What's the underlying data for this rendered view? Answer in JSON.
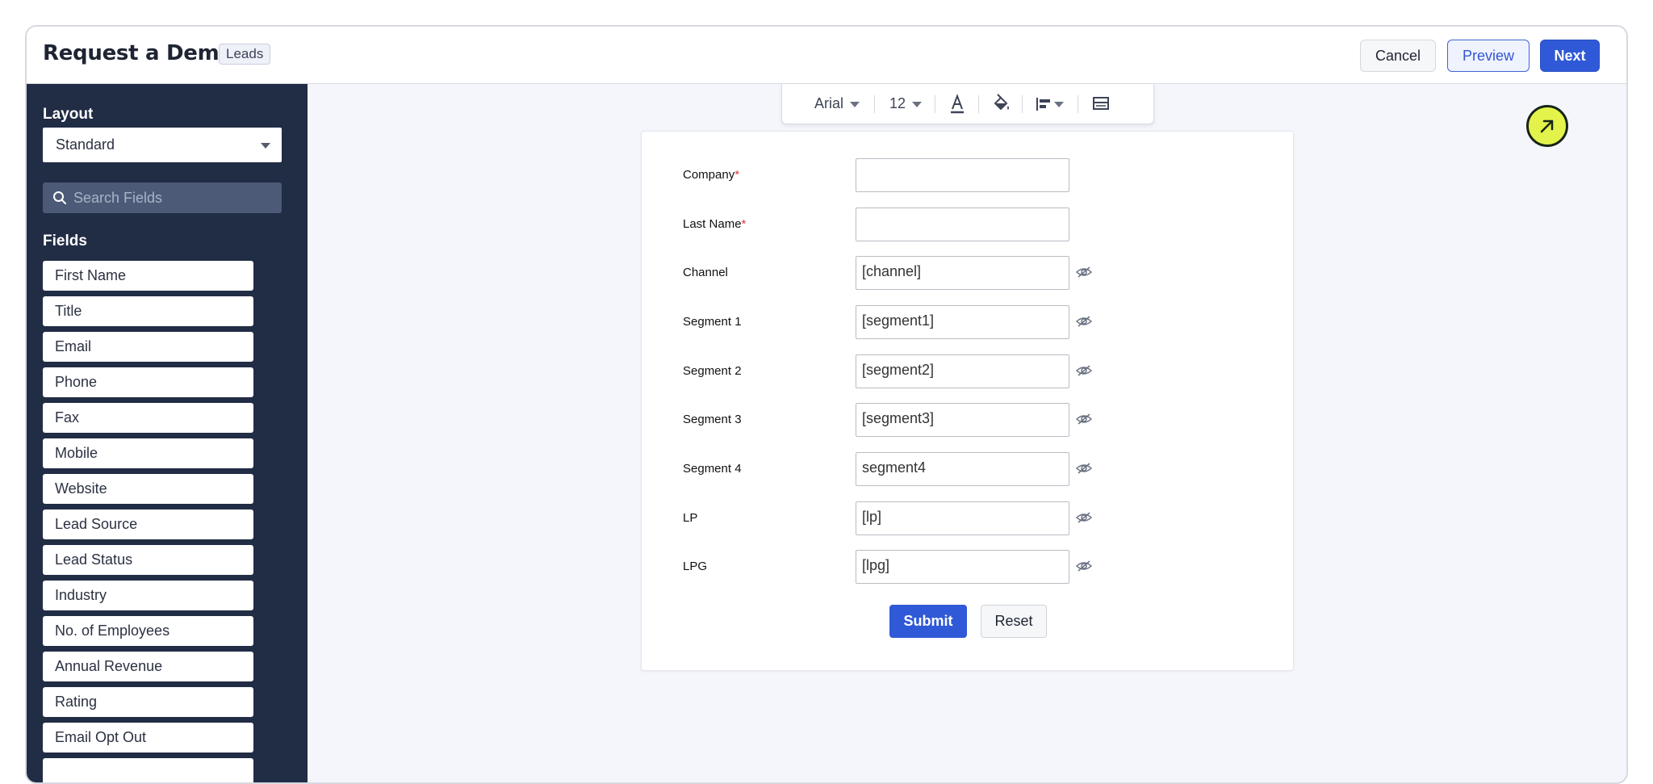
{
  "header": {
    "title": "Request a Demo",
    "badge": "Leads",
    "cancel_label": "Cancel",
    "preview_label": "Preview",
    "next_label": "Next"
  },
  "sidebar": {
    "layout_label": "Layout",
    "layout_value": "Standard",
    "search_placeholder": "Search Fields",
    "fields_label": "Fields",
    "fields": [
      "First Name",
      "Title",
      "Email",
      "Phone",
      "Fax",
      "Mobile",
      "Website",
      "Lead Source",
      "Lead Status",
      "Industry",
      "No. of Employees",
      "Annual Revenue",
      "Rating",
      "Email Opt Out"
    ]
  },
  "toolbar": {
    "font": "Arial",
    "size": "12",
    "icons": [
      "text-color-icon",
      "fill-color-icon",
      "align-icon",
      "layout-icon"
    ]
  },
  "form": {
    "rows": [
      {
        "label": "Company",
        "required": "*",
        "value": ""
      },
      {
        "label": "Last Name",
        "required": "*",
        "value": ""
      },
      {
        "label": "Channel",
        "value": "[channel]",
        "hidden": true
      },
      {
        "label": "Segment 1",
        "value": "[segment1]",
        "hidden": true
      },
      {
        "label": "Segment 2",
        "value": "[segment2]",
        "hidden": true
      },
      {
        "label": "Segment 3",
        "value": "[segment3]",
        "hidden": true
      },
      {
        "label": "Segment 4",
        "value": "segment4",
        "hidden": true
      },
      {
        "label": "LP",
        "value": "[lp]",
        "hidden": true
      },
      {
        "label": "LPG",
        "value": "[lpg]",
        "hidden": true
      }
    ],
    "submit_label": "Submit",
    "reset_label": "Reset"
  },
  "colors": {
    "accent": "#2f59d6",
    "sidebar_bg": "#212c45",
    "cursor": "#e3f34c"
  }
}
